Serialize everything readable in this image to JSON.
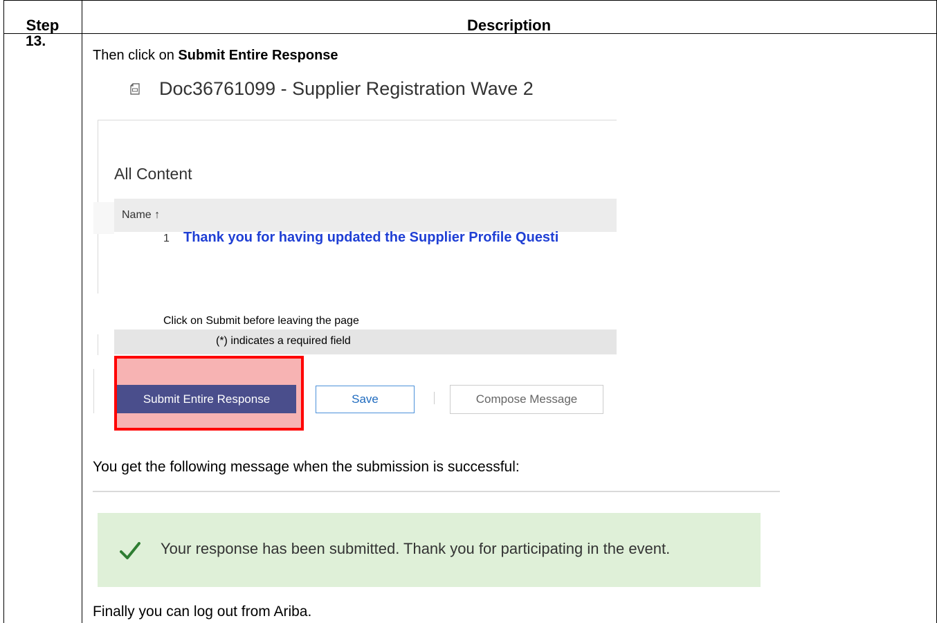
{
  "table": {
    "col_step": "Step",
    "col_description": "Description",
    "step_number": "13."
  },
  "instruction": {
    "prefix": "Then click on ",
    "emphasis": "Submit Entire Response"
  },
  "screenshot": {
    "doc_title": "Doc36761099 - Supplier Registration Wave 2",
    "section_title": "All Content",
    "column_name": "Name",
    "sort_icon": "arrow-up-icon",
    "row_number": "1",
    "row_text": "Thank you for having updated the Supplier Profile Questi",
    "submit_note": "Click on Submit before leaving the page",
    "required_note": "(*) indicates a required field",
    "buttons": {
      "submit": "Submit Entire Response",
      "save": "Save",
      "compose": "Compose Message"
    },
    "highlight_color": "#ff0000"
  },
  "result_intro": "You get the following message when the submission is successful:",
  "success_message": {
    "icon": "check-icon",
    "text": "Your response has been submitted.  Thank you for participating in the event."
  },
  "final_line": "Finally you can log out from Ariba."
}
